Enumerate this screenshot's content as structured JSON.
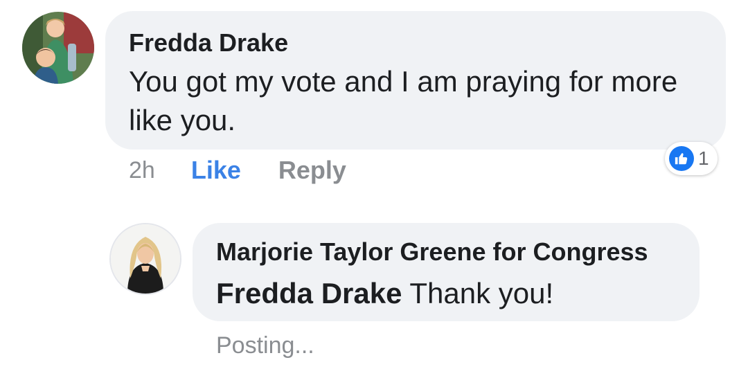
{
  "comment": {
    "author": "Fredda Drake",
    "text": "You got my vote and I am praying for more like you.",
    "timestamp": "2h",
    "like_label": "Like",
    "reply_label": "Reply",
    "reaction_count": "1",
    "reaction_icon": "thumbs-up-icon"
  },
  "reply": {
    "author": "Marjorie Taylor Greene for Congress",
    "mention": "Fredda Drake",
    "text": "Thank you!",
    "status": "Posting..."
  },
  "colors": {
    "bubble": "#f0f2f5",
    "link_blue": "#3b82e6",
    "muted": "#8a8d91",
    "like_badge": "#1877f2"
  }
}
